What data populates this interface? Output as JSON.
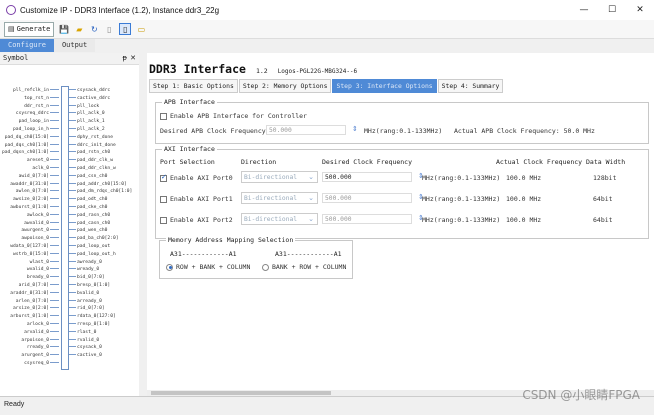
{
  "window": {
    "title": "Customize IP - DDR3 Interface (1.2), Instance ddr3_22g",
    "minimize_glyph": "—",
    "maximize_glyph": "☐",
    "close_glyph": "✕"
  },
  "toolbar": {
    "generate_label": "Generate",
    "icons": [
      "generate-icon",
      "save-icon",
      "open-icon",
      "refresh-icon",
      "doc-icon",
      "symbol-view-icon",
      "comment-icon"
    ]
  },
  "tabs": [
    "Configure",
    "Output"
  ],
  "symbol_panel": {
    "title": "Symbol",
    "pin_glyph": "ᵽ",
    "close_glyph": "✕",
    "left_ports": [
      "pll_refclk_in",
      "top_rst_n",
      "ddr_rst_n",
      "csysreq_ddrc",
      "pad_loop_in",
      "pad_loop_in_h",
      "pad_dq_ch0[15:0]",
      "pad_dqs_ch0[1:0]",
      "pad_dqsn_ch0[1:0]",
      "areset_0",
      "aclk_0",
      "awid_0[7:0]",
      "awaddr_0[31:0]",
      "awlen_0[7:0]",
      "awsize_0[2:0]",
      "awburst_0[1:0]",
      "awlock_0",
      "awvalid_0",
      "awurgent_0",
      "awpoison_0",
      "wdata_0[127:0]",
      "wstrb_0[15:0]",
      "wlast_0",
      "wvalid_0",
      "bready_0",
      "arid_0[7:0]",
      "araddr_0[31:0]",
      "arlen_0[7:0]",
      "arsize_0[2:0]",
      "arburst_0[1:0]",
      "arlock_0",
      "arvalid_0",
      "arpoison_0",
      "rready_0",
      "arurgent_0",
      "csysreq_0"
    ],
    "right_ports": [
      "csysack_ddrc",
      "cactive_ddrc",
      "pll_lock",
      "pll_aclk_0",
      "pll_aclk_1",
      "pll_aclk_2",
      "dphy_rst_done",
      "ddrc_init_done",
      "pad_rstn_ch0",
      "pad_ddr_clk_w",
      "pad_ddr_clkn_w",
      "pad_csn_ch0",
      "pad_addr_ch0[15:0]",
      "pad_dm_rdqs_ch0[1:0]",
      "pad_odt_ch0",
      "pad_cke_ch0",
      "pad_rasn_ch0",
      "pad_casn_ch0",
      "pad_wen_ch0",
      "pad_ba_ch0[2:0]",
      "pad_loop_out",
      "pad_loop_out_h",
      "awready_0",
      "wready_0",
      "bid_0[7:0]",
      "bresp_0[1:0]",
      "bvalid_0",
      "arready_0",
      "rid_0[7:0]",
      "rdata_0[127:0]",
      "rresp_0[1:0]",
      "rlast_0",
      "rvalid_0",
      "csysack_0",
      "cactive_0"
    ]
  },
  "main": {
    "title": "DDR3 Interface",
    "version": "1.2",
    "part": "Logos-PGL22G-MBG324--6",
    "steps": [
      "Step 1: Basic Options",
      "Step 2: Memory Options",
      "Step 3: Interface Options",
      "Step 4: Summary"
    ],
    "active_step": 2,
    "apb": {
      "group_label": "APB Interface",
      "enable_label": "Enable APB Interface for Controller",
      "desired_label": "Desired APB Clock Frequency:",
      "desired_value": "50.000",
      "range_label": "MHz(rang:0.1-133MHz)",
      "actual_label": "Actual APB Clock Frequency: 50.0 MHz"
    },
    "axi": {
      "group_label": "AXI Interface",
      "headers": {
        "port_selection": "Port Selection",
        "direction": "Direction",
        "desired_freq": "Desired Clock Frequency",
        "actual_freq": "Actual Clock Frequency",
        "data_width": "Data Width"
      },
      "ports": [
        {
          "label": "Enable AXI Port0",
          "checked": true,
          "direction": "Bi-directional",
          "freq": "500.000",
          "range": "MHz(rang:0.1-133MHz)",
          "actual": "100.0 MHz",
          "width": "128bit"
        },
        {
          "label": "Enable AXI Port1",
          "checked": false,
          "direction": "Bi-directional",
          "freq": "500.000",
          "range": "MHz(rang:0.1-133MHz)",
          "actual": "100.0 MHz",
          "width": "64bit"
        },
        {
          "label": "Enable AXI Port2",
          "checked": false,
          "direction": "Bi-directional",
          "freq": "500.000",
          "range": "MHz(rang:0.1-133MHz)",
          "actual": "100.0 MHz",
          "width": "64bit"
        }
      ]
    },
    "mapping": {
      "group_label": "Memory Address Mapping Selection",
      "col1_header": "A31------------A1",
      "col2_header": "A31------------A1",
      "option1": "ROW + BANK + COLUMN",
      "option2": "BANK + ROW + COLUMN",
      "selected": 0
    }
  },
  "status": {
    "text": "Ready"
  },
  "watermark": "CSDN @小眼睛FPGA",
  "colors": {
    "accent": "#4f8ad6",
    "port_line": "#7a9ccc"
  }
}
